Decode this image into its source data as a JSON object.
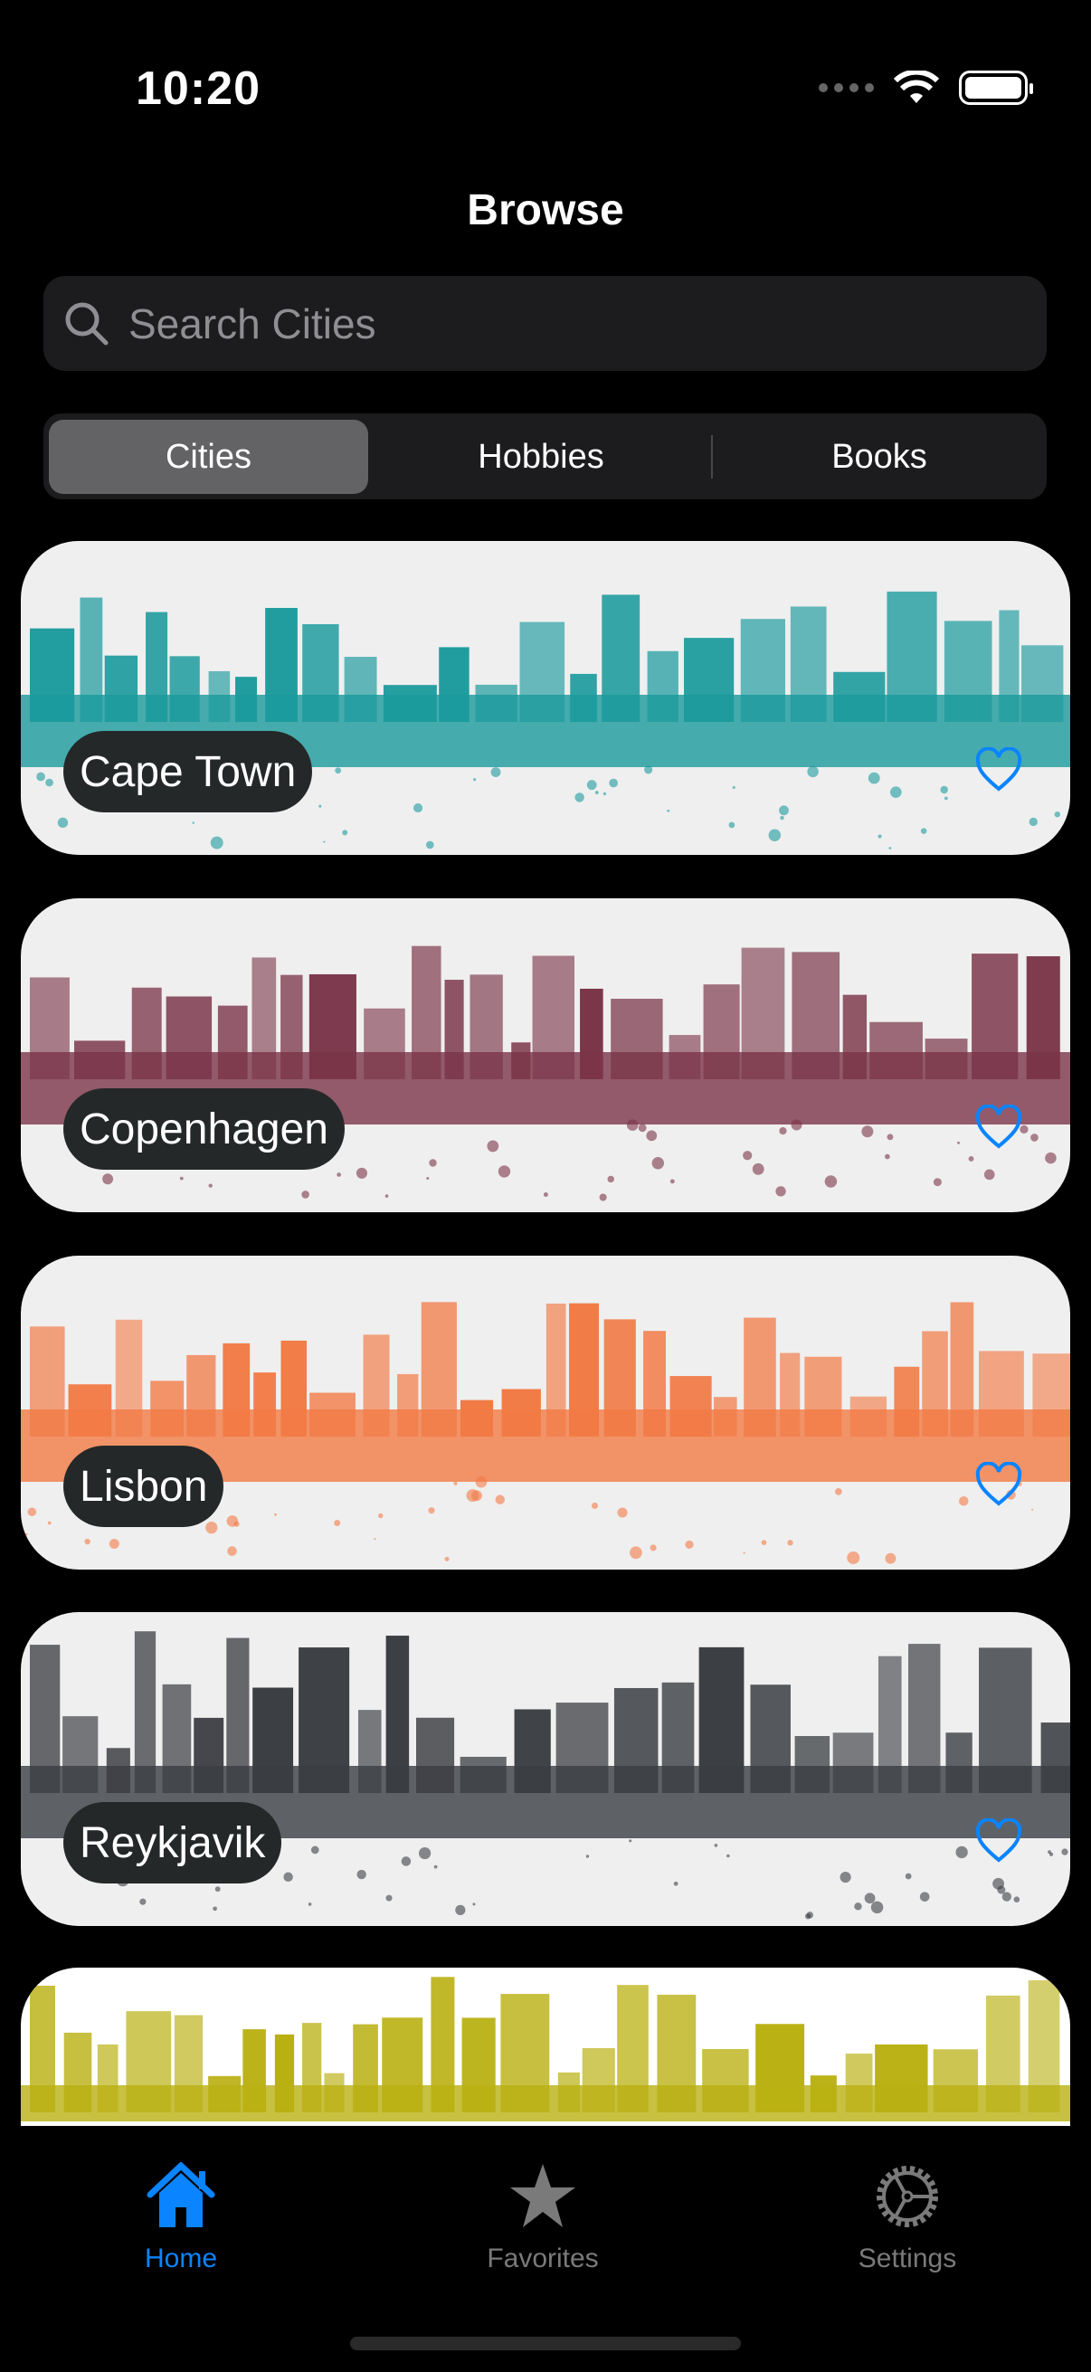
{
  "status": {
    "time": "10:20"
  },
  "header": {
    "title": "Browse"
  },
  "search": {
    "placeholder": "Search Cities"
  },
  "segments": [
    {
      "label": "Cities",
      "selected": true
    },
    {
      "label": "Hobbies"
    },
    {
      "label": "Books"
    }
  ],
  "cards": [
    {
      "name": "Cape Town",
      "color": "#1a9a9c",
      "favorite": false
    },
    {
      "name": "Copenhagen",
      "color": "#7a3448",
      "favorite": false
    },
    {
      "name": "Lisbon",
      "color": "#f27a45",
      "favorite": false
    },
    {
      "name": "Reykjavik",
      "color": "#3a3d42",
      "favorite": false
    },
    {
      "name": "",
      "color": "#b9b012",
      "favorite": false
    }
  ],
  "tabs": [
    {
      "label": "Home",
      "icon": "house-icon",
      "active": true
    },
    {
      "label": "Favorites",
      "icon": "star-icon"
    },
    {
      "label": "Settings",
      "icon": "gear-icon"
    }
  ],
  "colors": {
    "accent": "#0a84ff",
    "inactive": "#7a7a7a"
  }
}
